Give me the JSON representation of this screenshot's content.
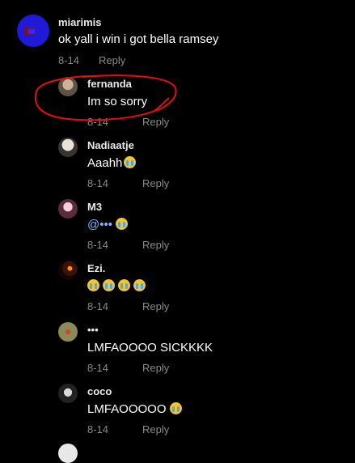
{
  "main_comment": {
    "username": "miarimis",
    "text": "ok yall i win i got bella ramsey",
    "date": "8-14",
    "reply_label": "Reply"
  },
  "replies": [
    {
      "username": "fernanda",
      "text": "Im so sorry",
      "date": "8-14",
      "reply_label": "Reply"
    },
    {
      "username": "Nadiaatje",
      "text": "Aaahh",
      "date": "8-14",
      "reply_label": "Reply"
    },
    {
      "username": "M3",
      "text": "@•••",
      "date": "8-14",
      "reply_label": "Reply"
    },
    {
      "username": "Ezi.",
      "text": "",
      "date": "8-14",
      "reply_label": "Reply"
    },
    {
      "username": "•••",
      "text": "LMFAOOOO SICKKKK",
      "date": "8-14",
      "reply_label": "Reply"
    },
    {
      "username": "coco",
      "text": "LMFAOOOOO",
      "date": "8-14",
      "reply_label": "Reply"
    }
  ],
  "colors": {
    "annotation": "#e01010",
    "mention": "#7db9ff"
  }
}
